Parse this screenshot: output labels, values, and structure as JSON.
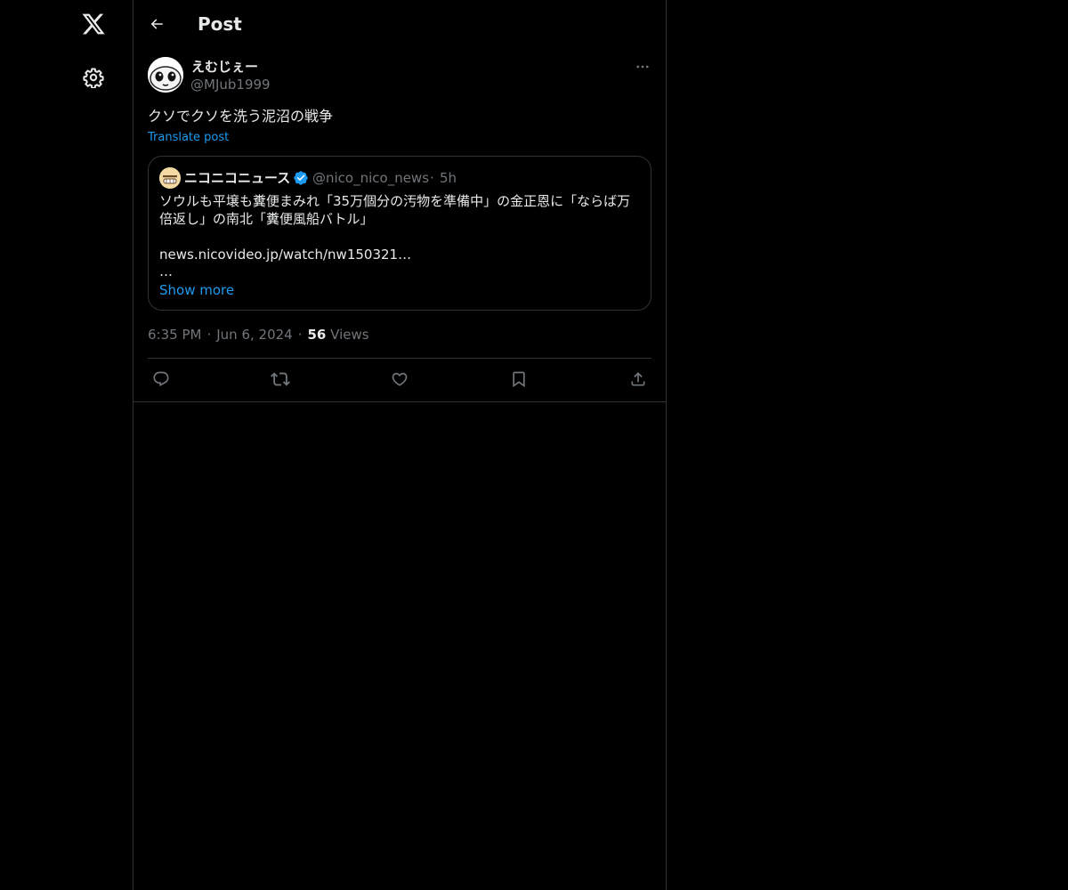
{
  "header": {
    "title": "Post"
  },
  "post": {
    "author": {
      "display_name": "えむじぇー",
      "handle": "@MJub1999"
    },
    "text": "クソでクソを洗う泥沼の戦争",
    "translate_label": "Translate post",
    "quote": {
      "author_name": "ニコニコニュース",
      "author_handle": "@nico_nico_news",
      "separator": "·",
      "time": "5h",
      "lines": [
        "ソウルも平壌も糞便まみれ「35万個分の汚物を準備中」の金正恩に「ならば万",
        "倍返し」の南北「糞便風船バトル」"
      ],
      "link": "news.nicovideo.jp/watch/nw150321…",
      "ellipsis": "…",
      "show_more": "Show more"
    },
    "meta": {
      "time": "6:35 PM",
      "date": "Jun 6, 2024",
      "views_count": "56",
      "views_label": "Views"
    }
  },
  "icons": {
    "logo": "x-logo-icon",
    "settings": "gear-icon",
    "back": "arrow-left-icon",
    "more": "more-horizontal-icon",
    "verified": "verified-badge-icon",
    "reply": "reply-icon",
    "repost": "repost-icon",
    "like": "heart-icon",
    "bookmark": "bookmark-icon",
    "share": "share-icon"
  },
  "colors": {
    "background": "#000000",
    "border": "#2f3336",
    "text": "#e7e9ea",
    "secondary": "#71767b",
    "accent": "#1d9bf0"
  }
}
